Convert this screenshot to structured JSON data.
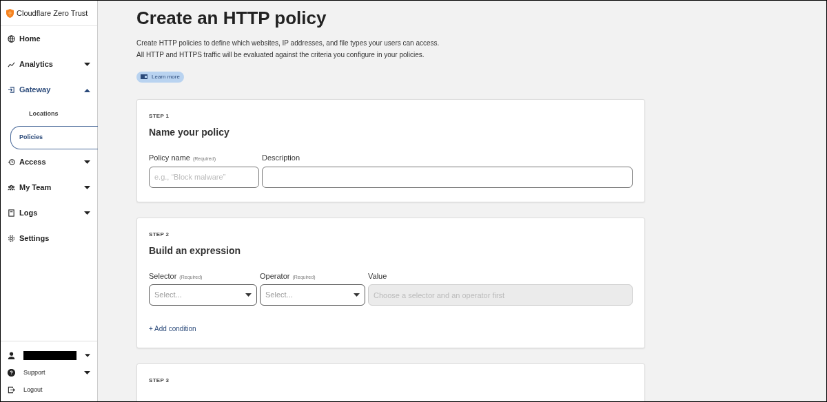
{
  "brand": {
    "name": "Cloudflare Zero Trust"
  },
  "sidebar": {
    "items": [
      {
        "label": "Home",
        "kind": "link",
        "selected": false
      },
      {
        "label": "Analytics",
        "kind": "group",
        "expanded": false,
        "selected": false
      },
      {
        "label": "Gateway",
        "kind": "group",
        "expanded": true,
        "selected": true,
        "children": [
          {
            "label": "Locations",
            "selected": false
          },
          {
            "label": "Policies",
            "selected": true
          }
        ]
      },
      {
        "label": "Access",
        "kind": "group",
        "expanded": false,
        "selected": false
      },
      {
        "label": "My Team",
        "kind": "group",
        "expanded": false,
        "selected": false
      },
      {
        "label": "Logs",
        "kind": "group",
        "expanded": false,
        "selected": false
      },
      {
        "label": "Settings",
        "kind": "link",
        "selected": false
      }
    ],
    "footer": [
      {
        "kind": "account",
        "redacted": true
      },
      {
        "kind": "menu",
        "label": "Support"
      },
      {
        "kind": "link",
        "label": "Logout"
      }
    ]
  },
  "page": {
    "title": "Create an HTTP policy",
    "description": "Create HTTP policies to define which websites, IP addresses, and file types your users can access. All HTTP and HTTPS traffic will be evaluated against the criteria you configure in your policies.",
    "learn_more": "Learn more"
  },
  "steps": [
    {
      "step": "STEP 1",
      "title": "Name your policy",
      "fields": [
        {
          "kind": "text",
          "label": "Policy name",
          "required": "(Required)",
          "placeholder": "e.g., “Block malware”",
          "disabled": false
        },
        {
          "kind": "text",
          "label": "Description",
          "disabled": false
        }
      ]
    },
    {
      "step": "STEP 2",
      "title": "Build an expression",
      "fields": [
        {
          "kind": "select",
          "label": "Selector",
          "required": "(Required)",
          "placeholder": "Select...",
          "disabled": false
        },
        {
          "kind": "select",
          "label": "Operator",
          "required": "(Required)",
          "placeholder": "Select...",
          "disabled": false
        },
        {
          "kind": "text",
          "label": "Value",
          "placeholder": "Choose a selector and an operator first",
          "disabled": true
        }
      ],
      "add_link": "+ Add condition"
    },
    {
      "step": "STEP 3"
    }
  ]
}
